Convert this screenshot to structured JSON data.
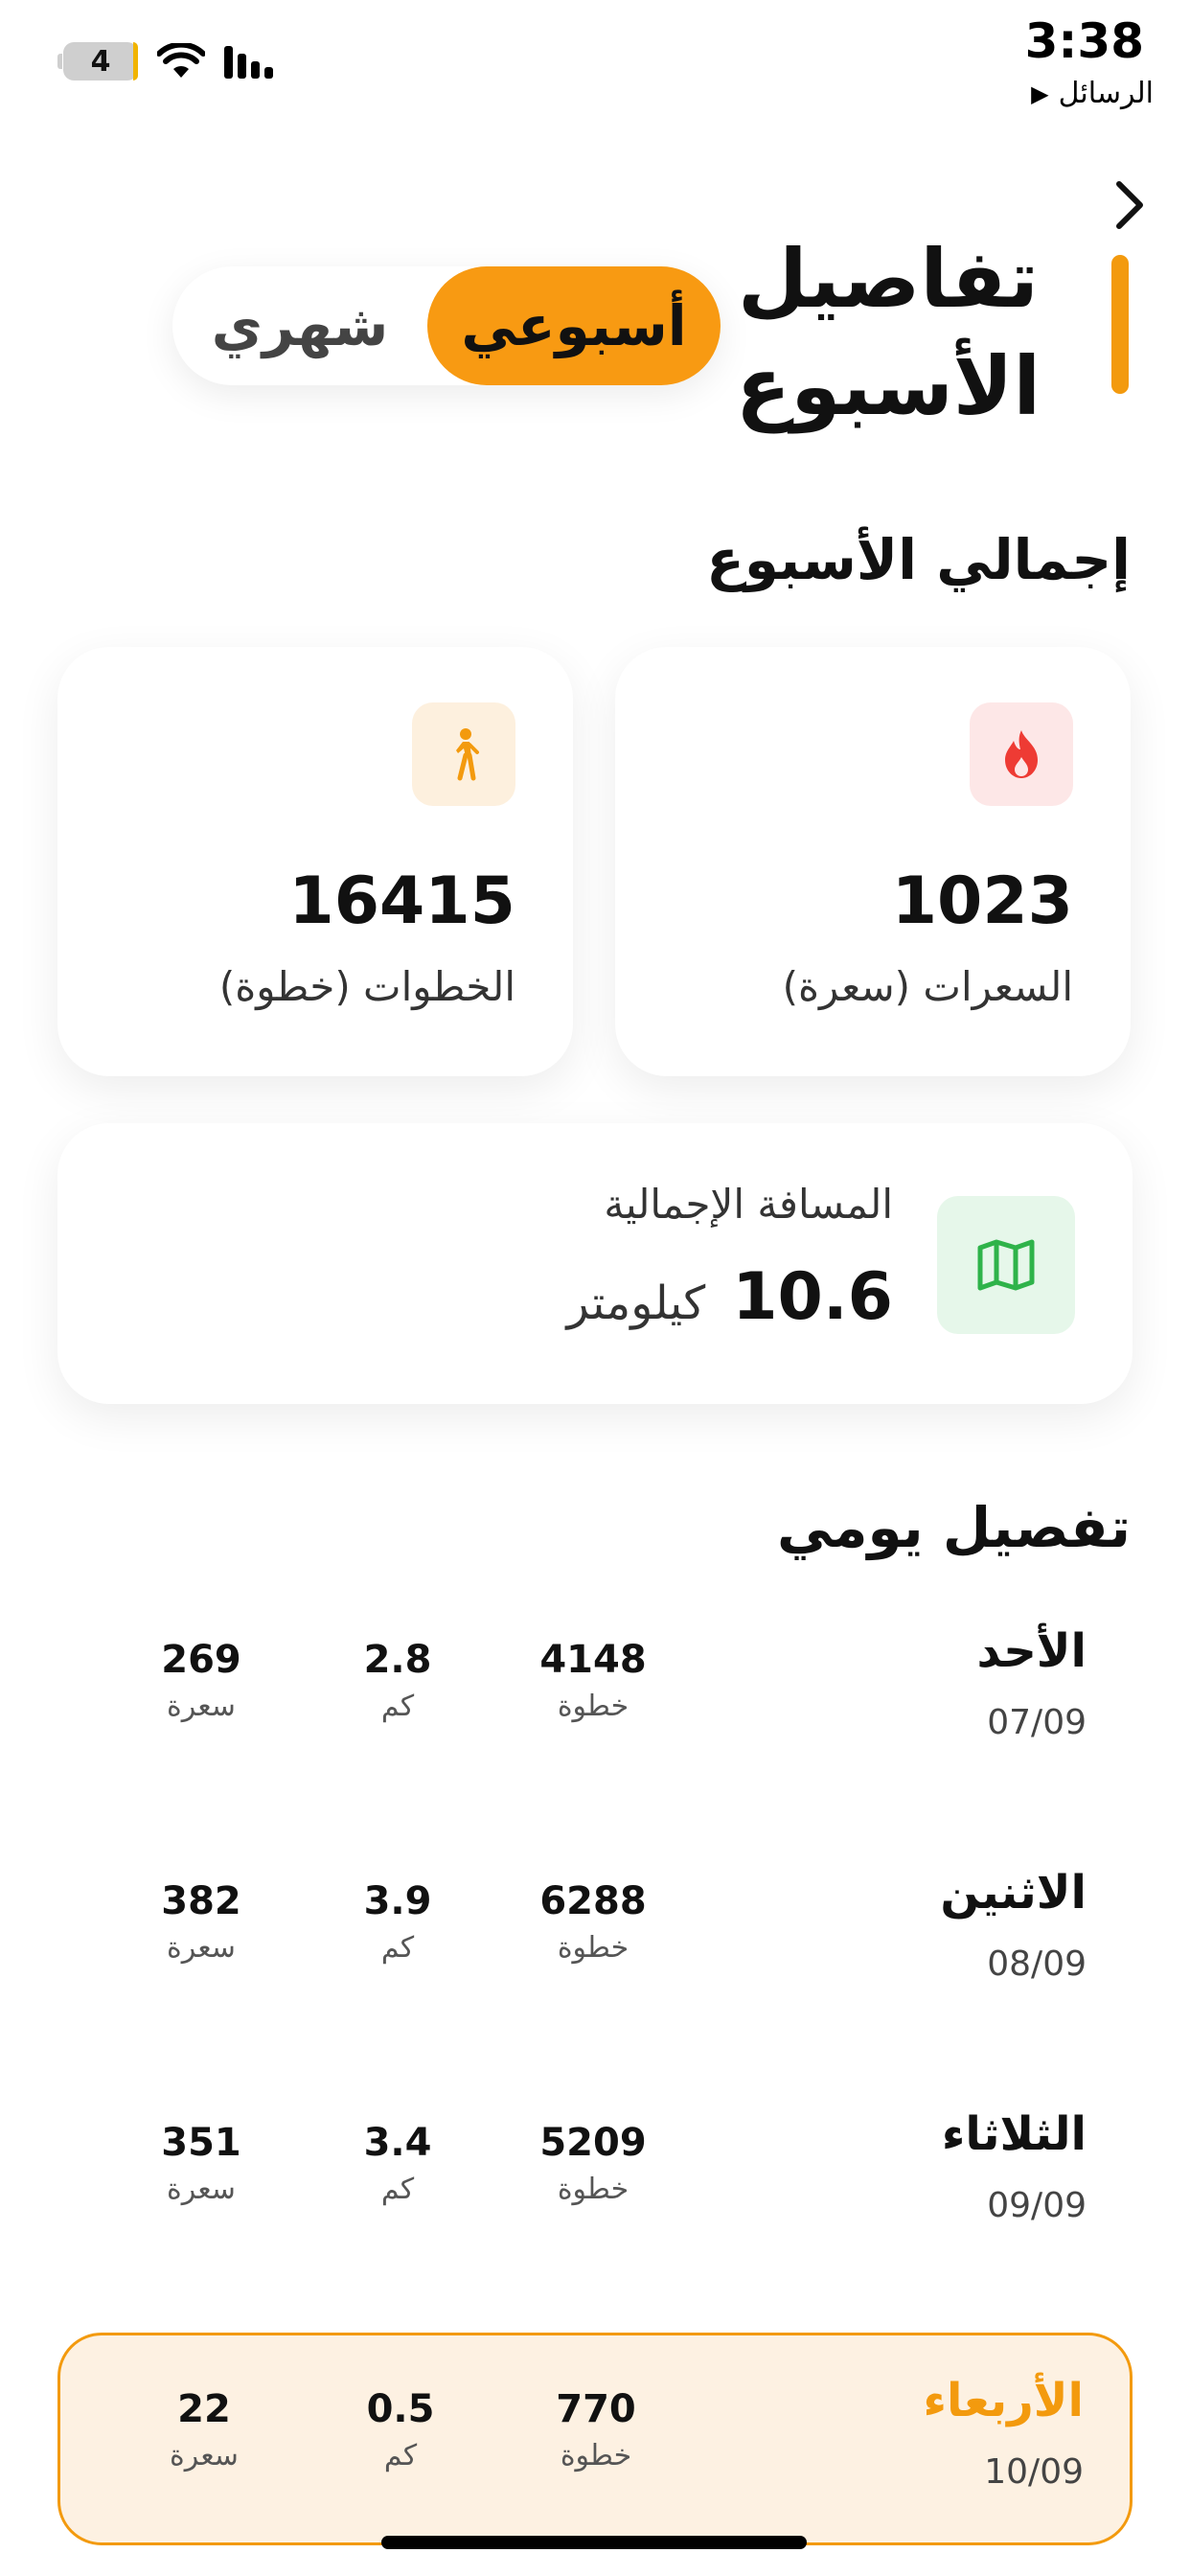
{
  "status_bar": {
    "time": "3:38",
    "back_label": "الرسائل",
    "back_arrow": "▶",
    "battery": "4"
  },
  "header": {
    "title": "تفاصيل الأسبوع",
    "segments": {
      "weekly": "أسبوعي",
      "monthly": "شهري",
      "selected": "weekly"
    }
  },
  "summary": {
    "title": "إجمالي الأسبوع",
    "calories": {
      "value": "1023",
      "label": "السعرات (سعرة)",
      "icon": "flame-icon"
    },
    "steps": {
      "value": "16415",
      "label": "الخطوات (خطوة)",
      "icon": "walking-person-icon"
    },
    "distance": {
      "label": "المسافة الإجمالية",
      "value": "10.6",
      "unit": "كيلومتر",
      "icon": "map-icon"
    }
  },
  "daily": {
    "title": "تفصيل يومي",
    "days": [
      {
        "name": "الأحد",
        "date": "07/09",
        "steps": "4148",
        "steps_unit": "خطوة",
        "km": "2.8",
        "km_unit": "كم",
        "cal": "269",
        "cal_unit": "سعرة"
      },
      {
        "name": "الاثنين",
        "date": "08/09",
        "steps": "6288",
        "steps_unit": "خطوة",
        "km": "3.9",
        "km_unit": "كم",
        "cal": "382",
        "cal_unit": "سعرة"
      },
      {
        "name": "الثلاثاء",
        "date": "09/09",
        "steps": "5209",
        "steps_unit": "خطوة",
        "km": "3.4",
        "km_unit": "كم",
        "cal": "351",
        "cal_unit": "سعرة"
      },
      {
        "name": "الأربعاء",
        "date": "10/09",
        "steps": "770",
        "steps_unit": "خطوة",
        "km": "0.5",
        "km_unit": "كم",
        "cal": "22",
        "cal_unit": "سعرة",
        "highlighted": true
      }
    ]
  },
  "colors": {
    "accent": "#f39a0e",
    "calories_tile": "#fde7e7",
    "steps_tile": "#fdf0de",
    "distance_tile": "#e6f7ea",
    "highlight_bg": "#fdf1e2"
  }
}
